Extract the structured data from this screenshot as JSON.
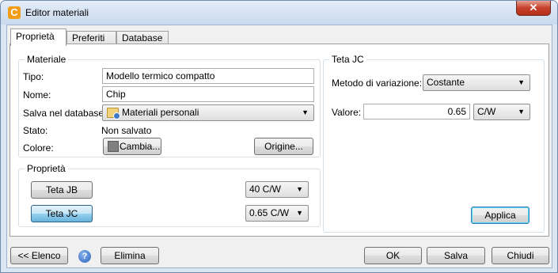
{
  "window": {
    "title": "Editor materiali",
    "close_glyph": "✕"
  },
  "tabs": [
    {
      "label": "Proprietà"
    },
    {
      "label": "Preferiti"
    },
    {
      "label": "Database"
    }
  ],
  "materiale": {
    "title": "Materiale",
    "tipo_label": "Tipo:",
    "tipo_value": "Modello termico compatto",
    "nome_label": "Nome:",
    "nome_value": "Chip",
    "salva_label": "Salva nel database:",
    "salva_value": "Materiali personali",
    "stato_label": "Stato:",
    "stato_value": "Non salvato",
    "colore_label": "Colore:",
    "cambia_label": "Cambia...",
    "origine_label": "Origine...",
    "colore_swatch": "#808080"
  },
  "proprieta": {
    "title": "Proprietà",
    "rows": [
      {
        "button": "Teta JB",
        "value": "40 C/W"
      },
      {
        "button": "Teta JC",
        "value": "0.65 C/W"
      }
    ]
  },
  "teta_jc": {
    "title": "Teta JC",
    "metodo_label": "Metodo di variazione:",
    "metodo_value": "Costante",
    "valore_label": "Valore:",
    "valore_value": "0.65",
    "unit_value": "C/W",
    "applica_label": "Applica"
  },
  "footer": {
    "elenco_label": "<< Elenco",
    "help_glyph": "?",
    "elimina_label": "Elimina",
    "ok_label": "OK",
    "salva_label": "Salva",
    "chiudi_label": "Chiudi"
  },
  "icons": {
    "app": "c-logo-icon",
    "help": "help-icon",
    "database": "folder-database-icon",
    "dropdown": "chevron-down-icon"
  },
  "colors": {
    "accent": "#f29d1a",
    "close": "#c6412b"
  }
}
